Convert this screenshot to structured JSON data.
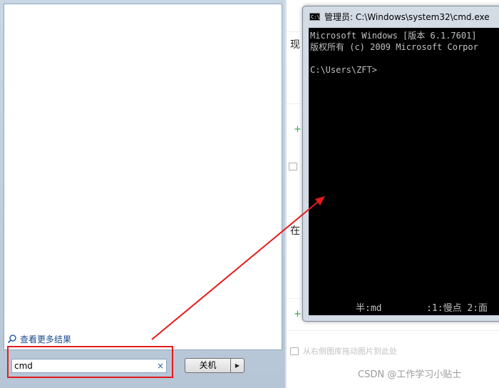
{
  "start_menu": {
    "see_more_results": "查看更多结果",
    "search_value": "cmd",
    "clear_glyph": "×",
    "shutdown_label": "关机",
    "shutdown_arrow": "▶"
  },
  "editor": {
    "text_line1": "现",
    "text_line2": "在",
    "plus": "+",
    "drag_hint": "从右侧图库拖动图片到此处",
    "watermark": "CSDN @工作学习小贴士"
  },
  "cmd": {
    "icon_text": "C:\\",
    "title": "管理员: C:\\Windows\\system32\\cmd.exe",
    "lines": [
      "Microsoft Windows [版本 6.1.7601]",
      "版权所有 (c) 2009 Microsoft Corpor",
      "",
      "C:\\Users\\ZFT>"
    ],
    "ime_bar": "半:md        :1:慢点 2:面"
  },
  "colors": {
    "annotation_red": "#e51b1b",
    "console_bg": "#000000",
    "console_text": "#c0c0c0"
  }
}
